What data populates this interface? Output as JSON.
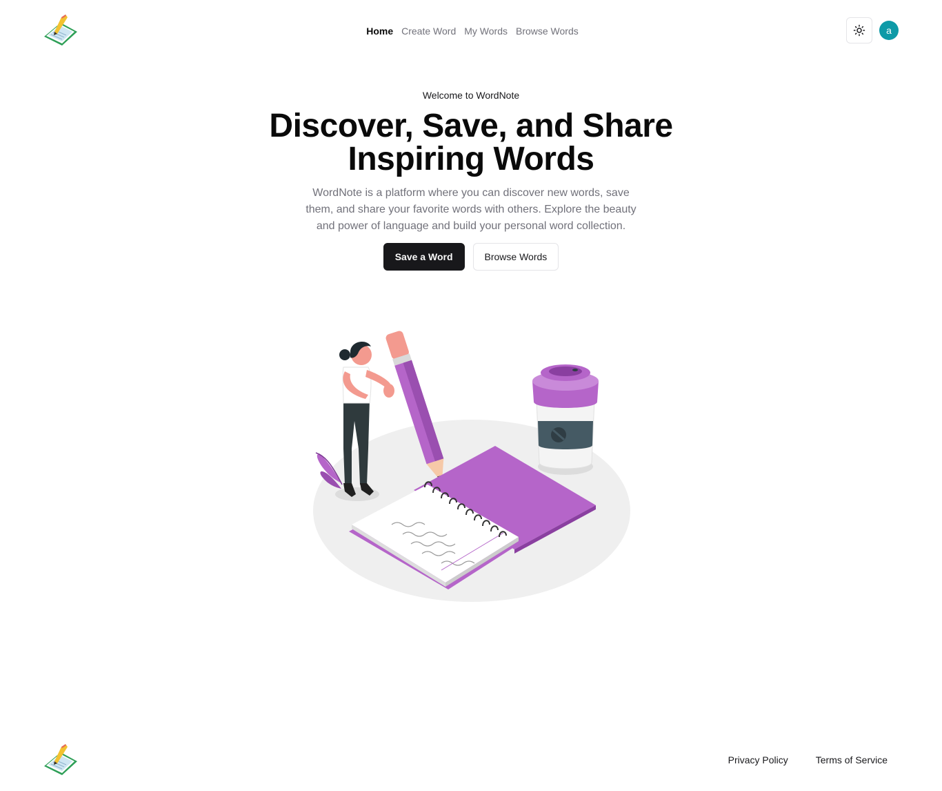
{
  "brand": {
    "logo_icon": "notebook-pencil-logo"
  },
  "nav": {
    "items": [
      {
        "label": "Home",
        "active": true
      },
      {
        "label": "Create Word",
        "active": false
      },
      {
        "label": "My Words",
        "active": false
      },
      {
        "label": "Browse Words",
        "active": false
      }
    ]
  },
  "header": {
    "theme_toggle_icon": "sun-icon",
    "avatar_initial": "a",
    "avatar_color": "#0e9aa7"
  },
  "hero": {
    "eyebrow": "Welcome to WordNote",
    "headline": "Discover, Save, and Share Inspiring Words",
    "description": "WordNote is a platform where you can discover new words, save them, and share your favorite words with others. Explore the beauty and power of language and build your personal word collection.",
    "primary_cta": "Save a Word",
    "secondary_cta": "Browse Words",
    "illustration": "woman-writing-notebook-illustration"
  },
  "footer": {
    "links": [
      "Privacy Policy",
      "Terms of Service"
    ]
  },
  "colors": {
    "accent_purple": "#b565c9",
    "primary_button": "#18181b",
    "muted_text": "#71717a"
  }
}
